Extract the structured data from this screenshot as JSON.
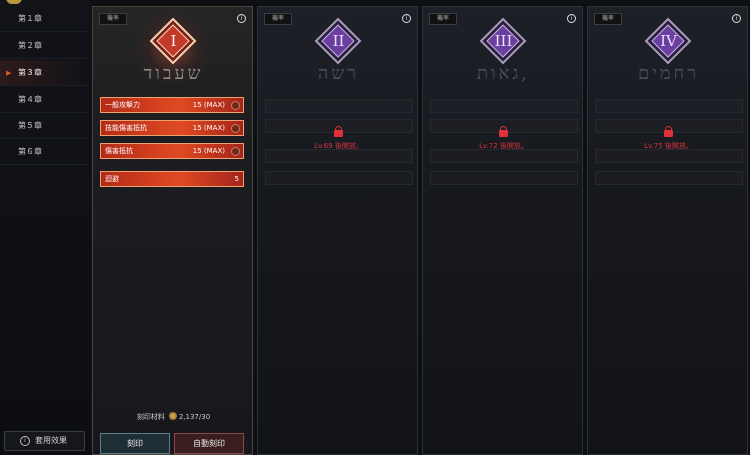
{
  "sidebar": {
    "chapters": [
      "第１章",
      "第２章",
      "第３章",
      "第４章",
      "第５章",
      "第６章"
    ],
    "active_index": 2,
    "effect_button": "套用效果"
  },
  "panels": [
    {
      "rate_label": "機率",
      "numeral": "I",
      "hebrew": "שעבוד",
      "unlocked": true,
      "stats": [
        {
          "name": "一般攻擊力",
          "value": "15 (MAX)"
        },
        {
          "name": "技能傷害抵抗",
          "value": "15 (MAX)"
        },
        {
          "name": "傷害抵抗",
          "value": "15 (MAX)"
        }
      ],
      "dodge": {
        "name": "迴避",
        "value": "5"
      },
      "material_label": "刻印材料",
      "material_count": "2,137/30",
      "engrave_button": "刻印",
      "auto_engrave_button": "自動刻印"
    },
    {
      "rate_label": "機率",
      "numeral": "II",
      "hebrew": "רשה",
      "unlocked": false,
      "lock_text": "Lv.69 後開放。"
    },
    {
      "rate_label": "機率",
      "numeral": "III",
      "hebrew": "גאות,",
      "unlocked": false,
      "lock_text": "Lv.72 後開放。"
    },
    {
      "rate_label": "機率",
      "numeral": "IV",
      "hebrew": "רחמים",
      "unlocked": false,
      "lock_text": "Lv.75 後開放。"
    }
  ],
  "colors": {
    "accent_red": "#e04a22",
    "locked_red": "#d2343c",
    "rune_purple": "#6a3fa0",
    "rune_red": "#c43a2a"
  }
}
